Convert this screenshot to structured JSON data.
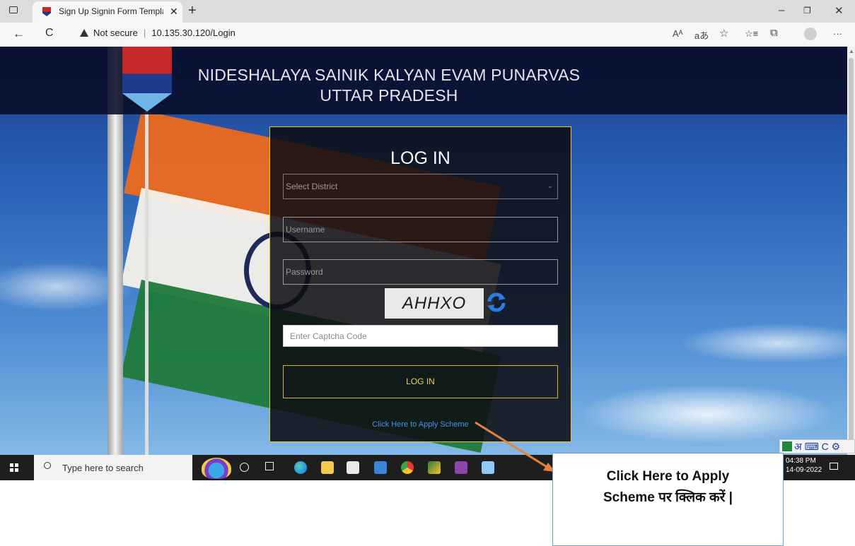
{
  "browser": {
    "tab_title": "Sign Up Signin Form Template E",
    "tab_close": "✕",
    "new_tab": "+",
    "security_label": "Not secure",
    "url": "10.135.30.120/Login",
    "toolbar_icons": [
      "read-aloud-icon",
      "translate-icon",
      "favorites-add-icon",
      "favorites-icon",
      "collections-icon",
      "profile-icon",
      "more-icon"
    ],
    "read_aloud_glyph": "Aᴬ",
    "translate_glyph": "aあ",
    "fav_add_glyph": "☆",
    "fav_glyph": "☆≡",
    "collections_glyph": "⧉",
    "more_glyph": "···",
    "minimize": "–",
    "restore": "❐",
    "close": "✕",
    "back": "←",
    "refresh": "C"
  },
  "header": {
    "line1": "NIDESHALAYA SAINIK KALYAN EVAM PUNARVAS",
    "line2": "UTTAR PRADESH"
  },
  "login_form": {
    "title": "LOG IN",
    "district_placeholder": "Select District",
    "username_placeholder": "Username",
    "password_placeholder": "Password",
    "captcha_text": "AHHXO",
    "captcha_placeholder": "Enter Captcha Code",
    "submit_label": "LOG IN",
    "apply_link": "Click Here to Apply Scheme"
  },
  "taskbar": {
    "search_placeholder": "Type here to search",
    "time": "04:38 PM",
    "date": "14-09-2022",
    "pinned_apps": [
      "edge-icon",
      "file-explorer-icon",
      "store-icon",
      "mail-icon",
      "chrome-icon",
      "app-icon",
      "visual-studio-icon",
      "app-icon"
    ],
    "ime_label": "अ ⌨ C ⚙"
  },
  "annotation": {
    "callout_text_line1": "Click Here to Apply",
    "callout_text_line2": "Scheme पर क्लिक करें |",
    "arrow_color": "#e8823a"
  }
}
